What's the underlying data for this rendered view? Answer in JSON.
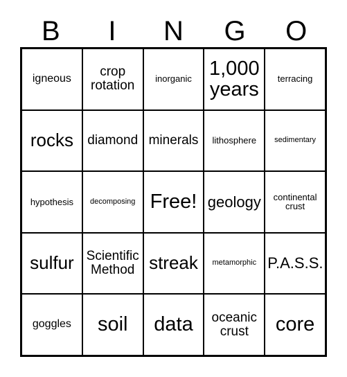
{
  "card": {
    "title": "BINGO",
    "header_letters": [
      "B",
      "I",
      "N",
      "G",
      "O"
    ],
    "free_space_label": "Free!",
    "colors": {
      "grid_line": "#000000",
      "text": "#000000",
      "background": "#ffffff"
    },
    "grid": {
      "columns": 5,
      "rows": 5,
      "cells": [
        [
          {
            "text": "igneous",
            "size": "md"
          },
          {
            "text": "crop\nrotation",
            "size": "lg"
          },
          {
            "text": "inorganic",
            "size": "sm"
          },
          {
            "text": "1,000\nyears",
            "size": "huge"
          },
          {
            "text": "terracing",
            "size": "sm"
          }
        ],
        [
          {
            "text": "rocks",
            "size": "xxl"
          },
          {
            "text": "diamond",
            "size": "lg"
          },
          {
            "text": "minerals",
            "size": "lg"
          },
          {
            "text": "lithosphere",
            "size": "sm"
          },
          {
            "text": "sedimentary",
            "size": "xs"
          }
        ],
        [
          {
            "text": "hypothesis",
            "size": "sm"
          },
          {
            "text": "decomposing",
            "size": "xs"
          },
          {
            "text": "Free!",
            "size": "huge"
          },
          {
            "text": "geology",
            "size": "xl"
          },
          {
            "text": "continental\ncrust",
            "size": "sm"
          }
        ],
        [
          {
            "text": "sulfur",
            "size": "xxl"
          },
          {
            "text": "Scientific\nMethod",
            "size": "lg"
          },
          {
            "text": "streak",
            "size": "xxl"
          },
          {
            "text": "metamorphic",
            "size": "xs"
          },
          {
            "text": "P.A.S.S.",
            "size": "xl"
          }
        ],
        [
          {
            "text": "goggles",
            "size": "md"
          },
          {
            "text": "soil",
            "size": "huge"
          },
          {
            "text": "data",
            "size": "huge"
          },
          {
            "text": "oceanic\ncrust",
            "size": "lg"
          },
          {
            "text": "core",
            "size": "huge"
          }
        ]
      ]
    }
  }
}
